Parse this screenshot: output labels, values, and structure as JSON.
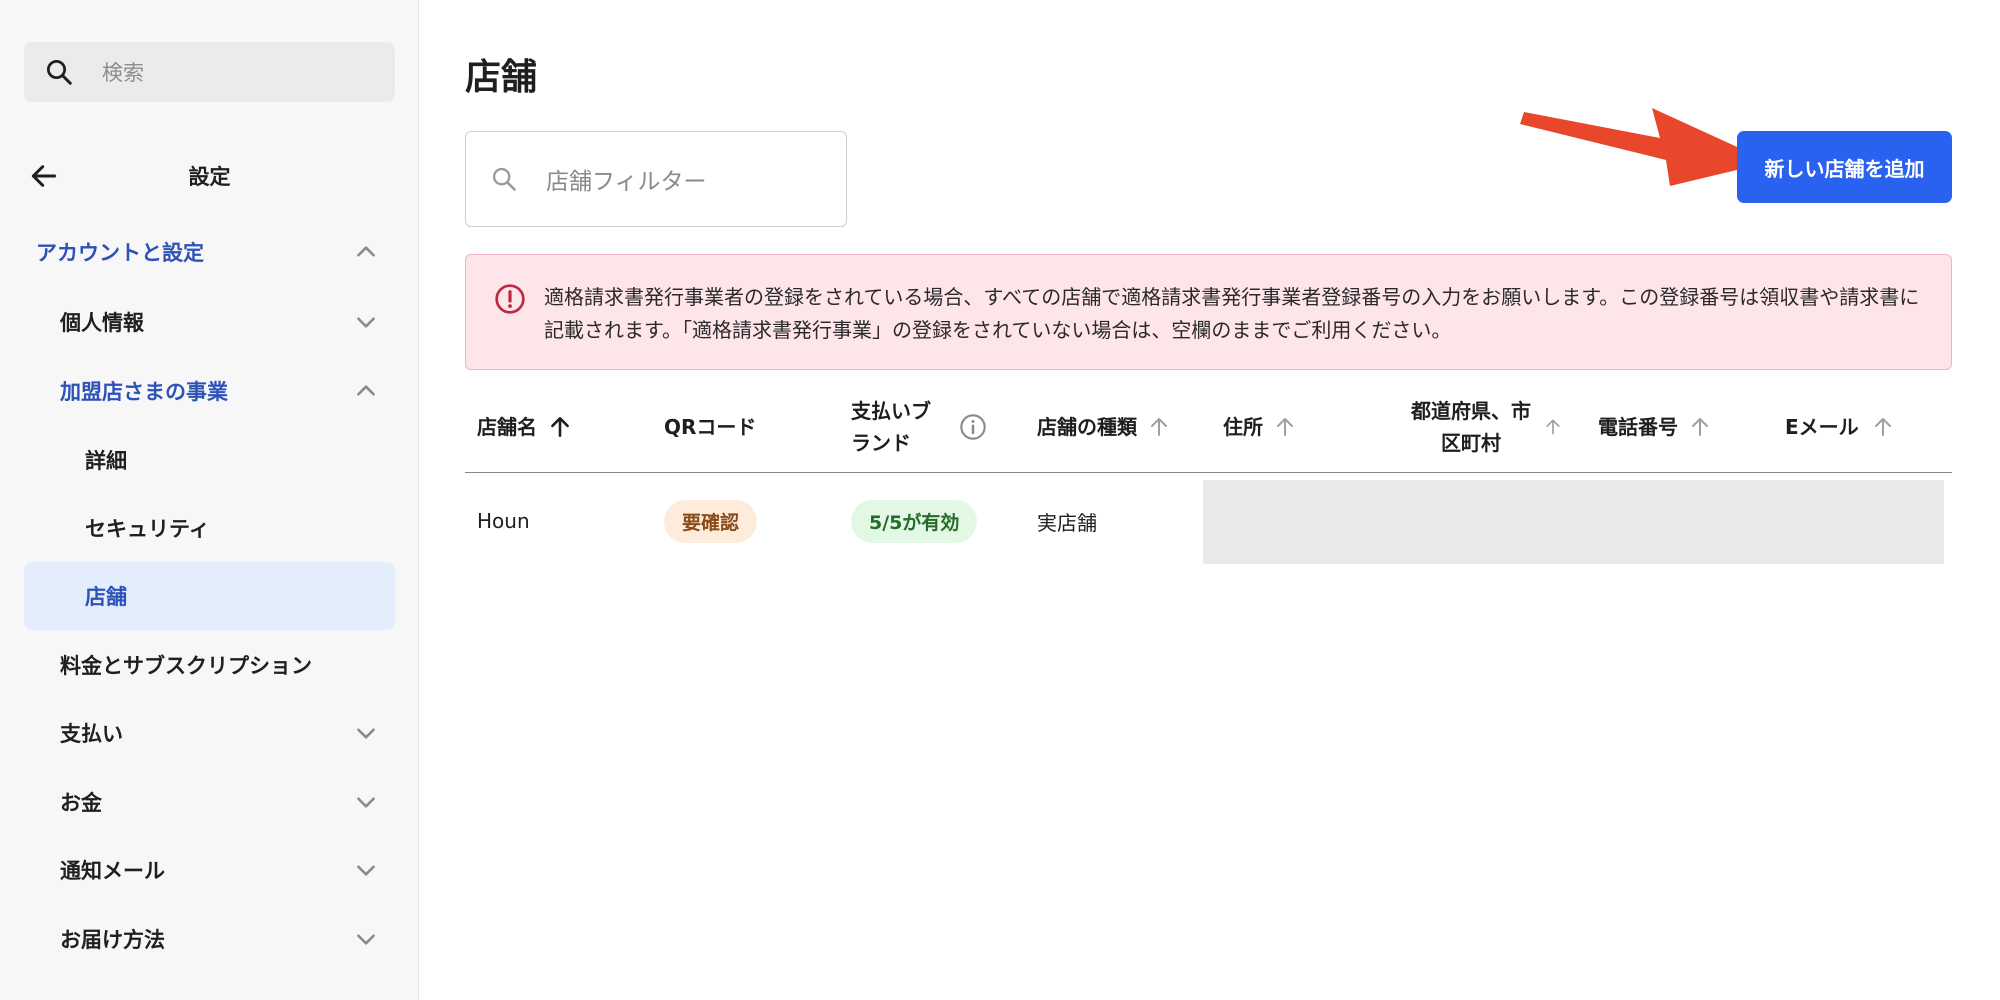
{
  "sidebar": {
    "search_placeholder": "検索",
    "back_title": "設定",
    "items": [
      {
        "label": "アカウントと設定"
      },
      {
        "label": "個人情報"
      },
      {
        "label": "加盟店さまの事業"
      },
      {
        "label": "詳細"
      },
      {
        "label": "セキュリティ"
      },
      {
        "label": "店舗"
      },
      {
        "label": "料金とサブスクリプション"
      },
      {
        "label": "支払い"
      },
      {
        "label": "お金"
      },
      {
        "label": "通知メール"
      },
      {
        "label": "お届け方法"
      }
    ]
  },
  "main": {
    "title": "店舗",
    "filter_placeholder": "店舗フィルター",
    "add_button": "新しい店舗を追加",
    "alert_text": "適格請求書発行事業者の登録をされている場合、すべての店舗で適格請求書発行事業者登録番号の入力をお願いします。この登録番号は領収書や請求書に記載されます。「適格請求書発行事業」の登録をされていない場合は、空欄のままでご利用ください。",
    "table": {
      "headers": {
        "name": "店舗名",
        "qr": "QRコード",
        "brand_line1": "支払いブ",
        "brand_line2": "ランド",
        "type": "店舗の種類",
        "address": "住所",
        "pref_line1": "都道府県、市",
        "pref_line2": "区町村",
        "phone": "電話番号",
        "email": "Eメール"
      },
      "rows": [
        {
          "name": "Houn",
          "qr_status": "要確認",
          "brand_status": "5/5が有効",
          "type": "実店舗"
        }
      ]
    }
  },
  "colors": {
    "accent": "#2a62f0",
    "nav_active": "#2d52b8",
    "alert_bg": "#fde5ea",
    "arrow": "#e8472b"
  }
}
